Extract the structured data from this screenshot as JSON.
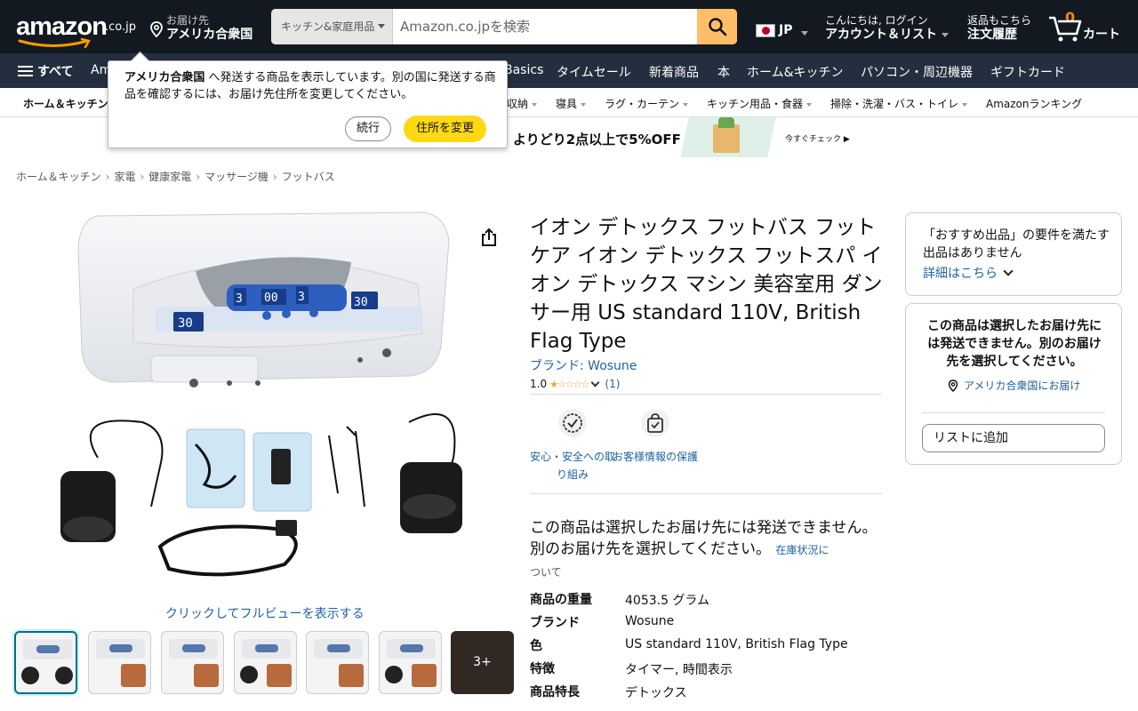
{
  "header": {
    "logo_word": "amazon",
    "logo_suffix": ".co.jp",
    "deliver_line1": "お届け先",
    "deliver_line2": "アメリカ合衆国",
    "search_category": "キッチン&家庭用品",
    "search_placeholder": "Amazon.co.jpを検索",
    "lang": "JP",
    "account_line1": "こんにちは, ログイン",
    "account_line2": "アカウント＆リスト",
    "orders_line1": "返品もこちら",
    "orders_line2": "注文履歴",
    "cart_count": "0",
    "cart_label": "カート"
  },
  "nav": {
    "all": "すべて",
    "items": [
      "Am",
      "Basics",
      "タイムセール",
      "新着商品",
      "本",
      "ホーム&キッチン",
      "パソコン・周辺機器",
      "ギフトカード"
    ]
  },
  "subnav": {
    "items": [
      "ホーム＆キッチン",
      "収納",
      "寝具",
      "ラグ・カーテン",
      "キッチン用品・食器",
      "掃除・洗濯・バス・トイレ",
      "Amazonランキング"
    ]
  },
  "banner": {
    "text": "よりどり2点以上で5%OFF",
    "cta": "今すぐチェック ▶"
  },
  "popover": {
    "bold": "アメリカ合衆国",
    "message": " へ発送する商品を表示しています。別の国に発送する商品を確認するには、お届け先住所を変更してください。",
    "continue": "続行",
    "change": "住所を変更"
  },
  "breadcrumb": [
    "ホーム＆キッチン",
    "家電",
    "健康家電",
    "マッサージ機",
    "フットバス"
  ],
  "gallery": {
    "fullview": "クリックしてフルビューを表示する",
    "more": "3+",
    "device_digits": [
      "30",
      "3",
      "00",
      "3",
      "30"
    ]
  },
  "product": {
    "title": "イオン デトックス フットバス フットケア イオン デトックス フットスパ イオン デトックス マシン 美容室用 ダンサー用 US standard 110V, British Flag Type",
    "brand": "ブランド: Wosune",
    "rating": "1.0",
    "stars": "★☆☆☆☆",
    "review_count": "(1)",
    "badge1": "安心・安全への取り組み",
    "badge2": "お客様情報の保護",
    "unavailable": "この商品は選択したお届け先には発送できません。別のお届け先を選択してください。",
    "stock_link": "在庫状況に",
    "stock_after": "ついて",
    "specs": [
      {
        "k": "商品の重量",
        "v": "4053.5 グラム"
      },
      {
        "k": "ブランド",
        "v": "Wosune"
      },
      {
        "k": "色",
        "v": "US standard 110V, British Flag Type"
      },
      {
        "k": "特徴",
        "v": "タイマー, 時間表示"
      },
      {
        "k": "商品特長",
        "v": "デトックス"
      }
    ]
  },
  "sidebar": {
    "box1_text": "「おすすめ出品」の要件を満たす出品はありません",
    "box1_link": "詳細はこちら",
    "box2_text": "この商品は選択したお届け先には発送できません。別のお届け先を選択してください。",
    "box2_loc": "アメリカ合衆国にお届け",
    "add_to_list": "リストに追加"
  },
  "colors": {
    "header_bg": "#131921",
    "nav_bg": "#232f3e",
    "search_button": "#febd69",
    "cta_yellow": "#ffd814",
    "link": "#2162a1",
    "star": "#f5a623",
    "cart_count": "#f08804"
  }
}
